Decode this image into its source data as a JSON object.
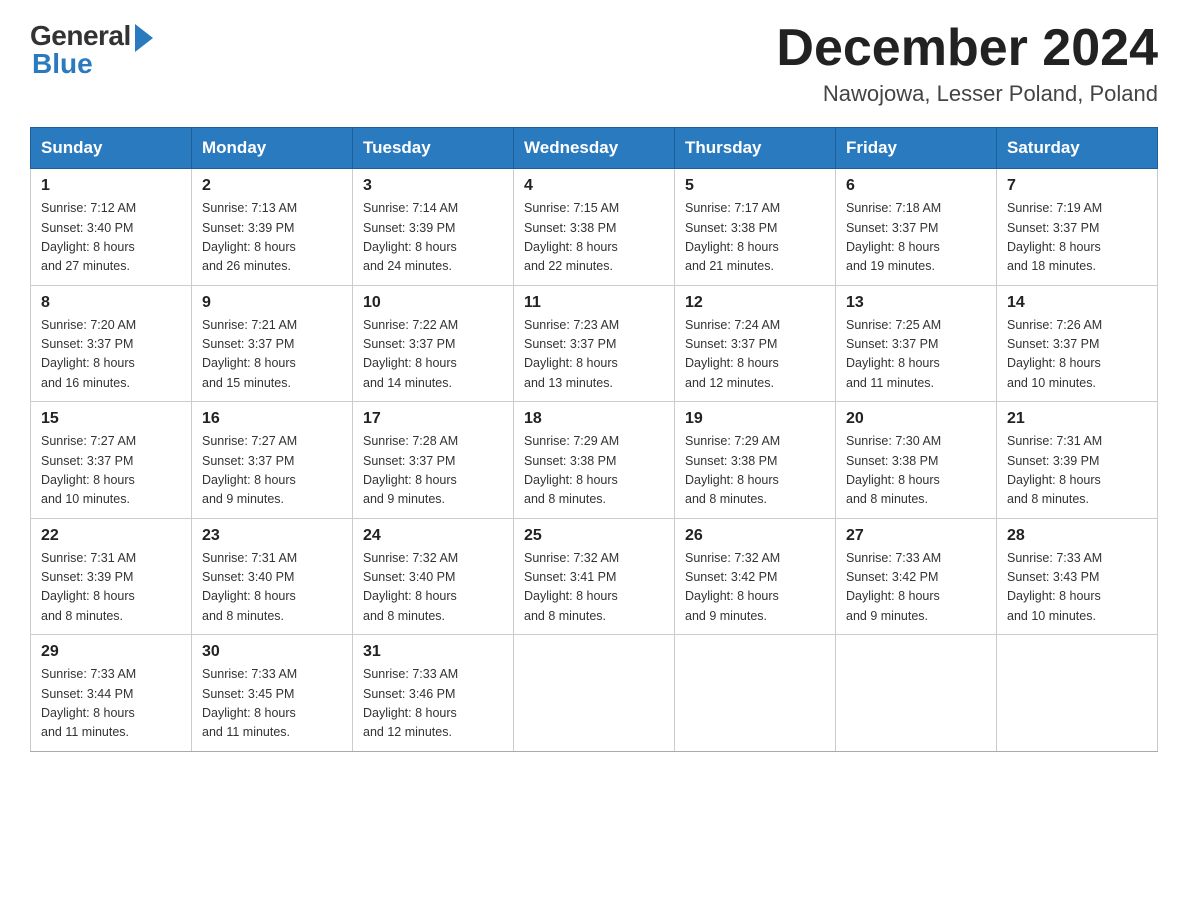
{
  "header": {
    "logo_general": "General",
    "logo_blue": "Blue",
    "month_title": "December 2024",
    "location": "Nawojowa, Lesser Poland, Poland"
  },
  "weekdays": [
    "Sunday",
    "Monday",
    "Tuesday",
    "Wednesday",
    "Thursday",
    "Friday",
    "Saturday"
  ],
  "weeks": [
    [
      {
        "day": "1",
        "sunrise": "7:12 AM",
        "sunset": "3:40 PM",
        "daylight": "8 hours and 27 minutes."
      },
      {
        "day": "2",
        "sunrise": "7:13 AM",
        "sunset": "3:39 PM",
        "daylight": "8 hours and 26 minutes."
      },
      {
        "day": "3",
        "sunrise": "7:14 AM",
        "sunset": "3:39 PM",
        "daylight": "8 hours and 24 minutes."
      },
      {
        "day": "4",
        "sunrise": "7:15 AM",
        "sunset": "3:38 PM",
        "daylight": "8 hours and 22 minutes."
      },
      {
        "day": "5",
        "sunrise": "7:17 AM",
        "sunset": "3:38 PM",
        "daylight": "8 hours and 21 minutes."
      },
      {
        "day": "6",
        "sunrise": "7:18 AM",
        "sunset": "3:37 PM",
        "daylight": "8 hours and 19 minutes."
      },
      {
        "day": "7",
        "sunrise": "7:19 AM",
        "sunset": "3:37 PM",
        "daylight": "8 hours and 18 minutes."
      }
    ],
    [
      {
        "day": "8",
        "sunrise": "7:20 AM",
        "sunset": "3:37 PM",
        "daylight": "8 hours and 16 minutes."
      },
      {
        "day": "9",
        "sunrise": "7:21 AM",
        "sunset": "3:37 PM",
        "daylight": "8 hours and 15 minutes."
      },
      {
        "day": "10",
        "sunrise": "7:22 AM",
        "sunset": "3:37 PM",
        "daylight": "8 hours and 14 minutes."
      },
      {
        "day": "11",
        "sunrise": "7:23 AM",
        "sunset": "3:37 PM",
        "daylight": "8 hours and 13 minutes."
      },
      {
        "day": "12",
        "sunrise": "7:24 AM",
        "sunset": "3:37 PM",
        "daylight": "8 hours and 12 minutes."
      },
      {
        "day": "13",
        "sunrise": "7:25 AM",
        "sunset": "3:37 PM",
        "daylight": "8 hours and 11 minutes."
      },
      {
        "day": "14",
        "sunrise": "7:26 AM",
        "sunset": "3:37 PM",
        "daylight": "8 hours and 10 minutes."
      }
    ],
    [
      {
        "day": "15",
        "sunrise": "7:27 AM",
        "sunset": "3:37 PM",
        "daylight": "8 hours and 10 minutes."
      },
      {
        "day": "16",
        "sunrise": "7:27 AM",
        "sunset": "3:37 PM",
        "daylight": "8 hours and 9 minutes."
      },
      {
        "day": "17",
        "sunrise": "7:28 AM",
        "sunset": "3:37 PM",
        "daylight": "8 hours and 9 minutes."
      },
      {
        "day": "18",
        "sunrise": "7:29 AM",
        "sunset": "3:38 PM",
        "daylight": "8 hours and 8 minutes."
      },
      {
        "day": "19",
        "sunrise": "7:29 AM",
        "sunset": "3:38 PM",
        "daylight": "8 hours and 8 minutes."
      },
      {
        "day": "20",
        "sunrise": "7:30 AM",
        "sunset": "3:38 PM",
        "daylight": "8 hours and 8 minutes."
      },
      {
        "day": "21",
        "sunrise": "7:31 AM",
        "sunset": "3:39 PM",
        "daylight": "8 hours and 8 minutes."
      }
    ],
    [
      {
        "day": "22",
        "sunrise": "7:31 AM",
        "sunset": "3:39 PM",
        "daylight": "8 hours and 8 minutes."
      },
      {
        "day": "23",
        "sunrise": "7:31 AM",
        "sunset": "3:40 PM",
        "daylight": "8 hours and 8 minutes."
      },
      {
        "day": "24",
        "sunrise": "7:32 AM",
        "sunset": "3:40 PM",
        "daylight": "8 hours and 8 minutes."
      },
      {
        "day": "25",
        "sunrise": "7:32 AM",
        "sunset": "3:41 PM",
        "daylight": "8 hours and 8 minutes."
      },
      {
        "day": "26",
        "sunrise": "7:32 AM",
        "sunset": "3:42 PM",
        "daylight": "8 hours and 9 minutes."
      },
      {
        "day": "27",
        "sunrise": "7:33 AM",
        "sunset": "3:42 PM",
        "daylight": "8 hours and 9 minutes."
      },
      {
        "day": "28",
        "sunrise": "7:33 AM",
        "sunset": "3:43 PM",
        "daylight": "8 hours and 10 minutes."
      }
    ],
    [
      {
        "day": "29",
        "sunrise": "7:33 AM",
        "sunset": "3:44 PM",
        "daylight": "8 hours and 11 minutes."
      },
      {
        "day": "30",
        "sunrise": "7:33 AM",
        "sunset": "3:45 PM",
        "daylight": "8 hours and 11 minutes."
      },
      {
        "day": "31",
        "sunrise": "7:33 AM",
        "sunset": "3:46 PM",
        "daylight": "8 hours and 12 minutes."
      },
      null,
      null,
      null,
      null
    ]
  ],
  "labels": {
    "sunrise": "Sunrise:",
    "sunset": "Sunset:",
    "daylight": "Daylight:"
  }
}
